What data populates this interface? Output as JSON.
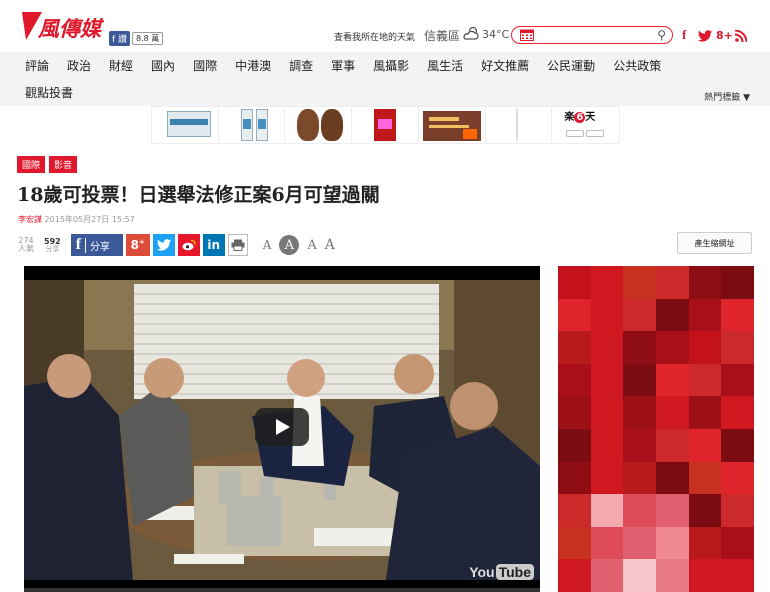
{
  "header": {
    "logo_text": "風傳媒",
    "fb_like": "f 讚",
    "fb_count": "8.8 萬",
    "weather_prompt": "查看我所在地的天氣",
    "city": "信義區",
    "temperature": "34°C",
    "search_placeholder": "",
    "social_icons": [
      "f",
      "twitter-icon",
      "8+",
      "rss-icon"
    ]
  },
  "nav": {
    "items": [
      "評論",
      "政治",
      "財經",
      "國內",
      "國際",
      "中港澳",
      "調查",
      "軍事",
      "風攝影",
      "風生活",
      "好文推薦",
      "公民運動",
      "公共政策"
    ],
    "row2": "觀點投書",
    "hot_tags": "熱門標籤 ▼"
  },
  "article": {
    "tags": [
      "國際",
      "影音"
    ],
    "headline": "18歲可投票！日選舉法修正案6月可望過關",
    "author": "李宏謀",
    "date": "2015年05月27日 15:57",
    "views_count": "274",
    "views_label": "人氣",
    "share_count": "592",
    "share_label": "分享",
    "fb_share_label": "分享",
    "font_sizes": [
      "A",
      "A",
      "A",
      "A"
    ],
    "shortlink_label": "產生縮網址"
  },
  "video": {
    "yt_you": "You",
    "yt_tube": "Tube"
  },
  "colors": {
    "brand": "#e0182c",
    "nav_bg": "#f3f3f3",
    "facebook": "#3b5998"
  }
}
